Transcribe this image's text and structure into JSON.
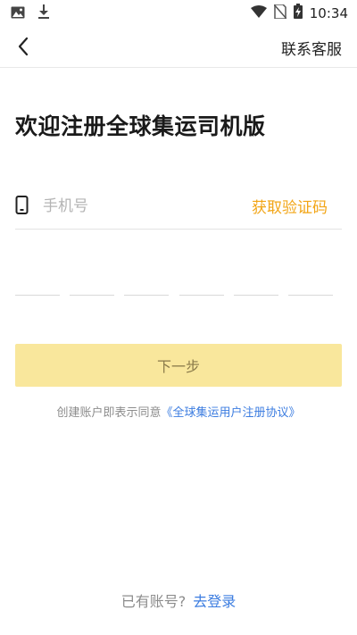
{
  "status_bar": {
    "time": "10:34",
    "left_icons": [
      "image-icon",
      "download-icon"
    ],
    "right_icons": [
      "wifi-icon",
      "no-sim-icon",
      "battery-charging-icon"
    ]
  },
  "nav": {
    "back_icon": "chevron-left-icon",
    "contact_label": "联系客服"
  },
  "title": "欢迎注册全球集运司机版",
  "phone": {
    "icon": "phone-icon",
    "placeholder": "手机号",
    "value": "",
    "get_code_label": "获取验证码"
  },
  "code": {
    "digits": [
      "",
      "",
      "",
      "",
      "",
      ""
    ]
  },
  "next_button": {
    "label": "下一步"
  },
  "agreement": {
    "prefix": "创建账户即表示同意",
    "link": "《全球集运用户注册协议》"
  },
  "login": {
    "prompt": "已有账号?",
    "link": "去登录"
  },
  "colors": {
    "accent_orange": "#f2a516",
    "link_blue": "#3b7ce0",
    "button_yellow": "#f9e79c"
  }
}
